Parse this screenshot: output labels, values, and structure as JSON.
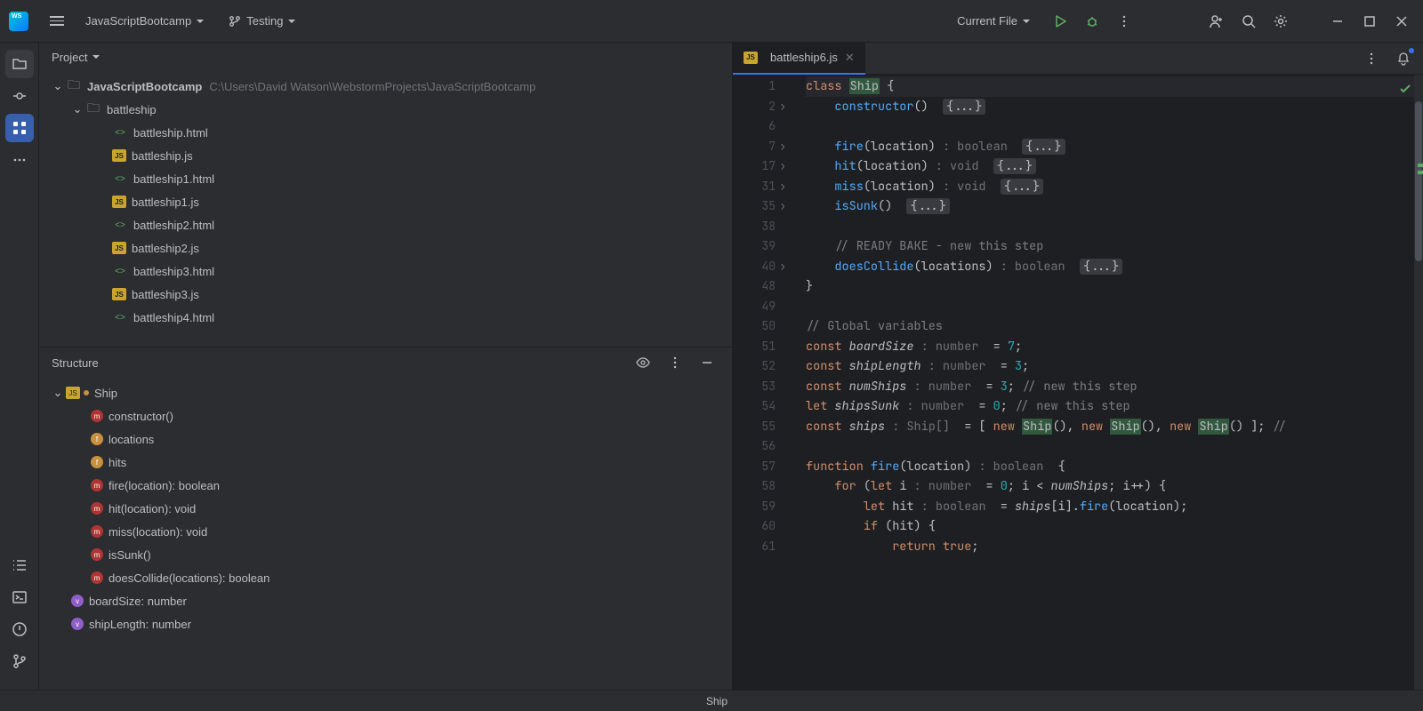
{
  "topbar": {
    "project_name": "JavaScriptBootcamp",
    "branch": "Testing",
    "run_config": "Current File"
  },
  "project_panel": {
    "title": "Project",
    "root": "JavaScriptBootcamp",
    "root_path": "C:\\Users\\David Watson\\WebstormProjects\\JavaScriptBootcamp",
    "folder": "battleship",
    "files": [
      {
        "name": "battleship.html",
        "type": "html"
      },
      {
        "name": "battleship.js",
        "type": "js"
      },
      {
        "name": "battleship1.html",
        "type": "html"
      },
      {
        "name": "battleship1.js",
        "type": "js"
      },
      {
        "name": "battleship2.html",
        "type": "html"
      },
      {
        "name": "battleship2.js",
        "type": "js"
      },
      {
        "name": "battleship3.html",
        "type": "html"
      },
      {
        "name": "battleship3.js",
        "type": "js"
      },
      {
        "name": "battleship4.html",
        "type": "html"
      }
    ]
  },
  "structure_panel": {
    "title": "Structure",
    "class_name": "Ship",
    "members": [
      {
        "icon": "method",
        "label": "constructor()"
      },
      {
        "icon": "field",
        "label": "locations"
      },
      {
        "icon": "field",
        "label": "hits"
      },
      {
        "icon": "method",
        "label": "fire(location): boolean"
      },
      {
        "icon": "method",
        "label": "hit(location): void"
      },
      {
        "icon": "method",
        "label": "miss(location): void"
      },
      {
        "icon": "method",
        "label": "isSunk()"
      },
      {
        "icon": "method",
        "label": "doesCollide(locations): boolean"
      }
    ],
    "globals": [
      {
        "icon": "var",
        "label": "boardSize: number"
      },
      {
        "icon": "var",
        "label": "shipLength: number"
      }
    ]
  },
  "editor": {
    "tab_name": "battleship6.js",
    "breadcrumb": "Ship",
    "gutter": [
      "1",
      "2",
      "6",
      "7",
      "17",
      "31",
      "35",
      "38",
      "39",
      "40",
      "48",
      "49",
      "50",
      "51",
      "52",
      "53",
      "54",
      "55",
      "56",
      "57",
      "58",
      "59",
      "60",
      "61"
    ],
    "folds": [
      1,
      3,
      4,
      5,
      6,
      9
    ],
    "lines": [
      {
        "t": "code",
        "segs": [
          [
            "kw",
            "class "
          ],
          [
            "cls",
            "Ship"
          ],
          [
            "",
            " {"
          ]
        ]
      },
      {
        "t": "fold",
        "segs": [
          [
            "",
            "    "
          ],
          [
            "fn",
            "constructor"
          ],
          [
            "",
            "()  "
          ],
          [
            "fold-badge",
            "{...}"
          ]
        ]
      },
      {
        "t": "blank"
      },
      {
        "t": "fold",
        "segs": [
          [
            "",
            "    "
          ],
          [
            "fn",
            "fire"
          ],
          [
            "",
            "("
          ],
          [
            "ident-nc",
            "location"
          ],
          [
            "",
            ") "
          ],
          [
            "hint",
            ": boolean"
          ],
          [
            "",
            "  "
          ],
          [
            "fold-badge",
            "{...}"
          ]
        ]
      },
      {
        "t": "fold",
        "segs": [
          [
            "",
            "    "
          ],
          [
            "fn",
            "hit"
          ],
          [
            "",
            "("
          ],
          [
            "ident-nc",
            "location"
          ],
          [
            "",
            ") "
          ],
          [
            "hint",
            ": void"
          ],
          [
            "",
            "  "
          ],
          [
            "fold-badge",
            "{...}"
          ]
        ]
      },
      {
        "t": "fold",
        "segs": [
          [
            "",
            "    "
          ],
          [
            "fn",
            "miss"
          ],
          [
            "",
            "("
          ],
          [
            "ident-nc",
            "location"
          ],
          [
            "",
            ") "
          ],
          [
            "hint",
            ": void"
          ],
          [
            "",
            "  "
          ],
          [
            "fold-badge",
            "{...}"
          ]
        ]
      },
      {
        "t": "fold",
        "segs": [
          [
            "",
            "    "
          ],
          [
            "fn",
            "isSunk"
          ],
          [
            "",
            "()  "
          ],
          [
            "fold-badge",
            "{...}"
          ]
        ]
      },
      {
        "t": "blank"
      },
      {
        "t": "code",
        "segs": [
          [
            "",
            "    "
          ],
          [
            "comment",
            "// READY BAKE - new this step"
          ]
        ]
      },
      {
        "t": "fold",
        "segs": [
          [
            "",
            "    "
          ],
          [
            "fn",
            "doesCollide"
          ],
          [
            "",
            "("
          ],
          [
            "ident-nc",
            "locations"
          ],
          [
            "",
            ") "
          ],
          [
            "hint",
            ": boolean"
          ],
          [
            "",
            "  "
          ],
          [
            "fold-badge",
            "{...}"
          ]
        ]
      },
      {
        "t": "code",
        "segs": [
          [
            "",
            "}"
          ]
        ]
      },
      {
        "t": "blank"
      },
      {
        "t": "code",
        "segs": [
          [
            "comment",
            "// Global variables"
          ]
        ]
      },
      {
        "t": "code",
        "segs": [
          [
            "kw",
            "const "
          ],
          [
            "ident",
            "boardSize"
          ],
          [
            "",
            " "
          ],
          [
            "hint",
            ": number"
          ],
          [
            "",
            "  = "
          ],
          [
            "num",
            "7"
          ],
          [
            "",
            ";"
          ]
        ]
      },
      {
        "t": "code",
        "segs": [
          [
            "kw",
            "const "
          ],
          [
            "ident",
            "shipLength"
          ],
          [
            "",
            " "
          ],
          [
            "hint",
            ": number"
          ],
          [
            "",
            "  = "
          ],
          [
            "num",
            "3"
          ],
          [
            "",
            ";"
          ]
        ]
      },
      {
        "t": "code",
        "segs": [
          [
            "kw",
            "const "
          ],
          [
            "ident",
            "numShips"
          ],
          [
            "",
            " "
          ],
          [
            "hint",
            ": number"
          ],
          [
            "",
            "  = "
          ],
          [
            "num",
            "3"
          ],
          [
            "",
            "; "
          ],
          [
            "comment",
            "// new this step"
          ]
        ]
      },
      {
        "t": "code",
        "segs": [
          [
            "kw",
            "let "
          ],
          [
            "ident",
            "shipsSunk"
          ],
          [
            "",
            " "
          ],
          [
            "hint",
            ": number"
          ],
          [
            "",
            "  = "
          ],
          [
            "num",
            "0"
          ],
          [
            "",
            "; "
          ],
          [
            "comment",
            "// new this step"
          ]
        ]
      },
      {
        "t": "code",
        "segs": [
          [
            "kw",
            "const "
          ],
          [
            "ident",
            "ships"
          ],
          [
            "",
            " "
          ],
          [
            "hint",
            ": Ship[]"
          ],
          [
            "",
            "  = [ "
          ],
          [
            "kw",
            "new "
          ],
          [
            "cls",
            "Ship"
          ],
          [
            "",
            "(), "
          ],
          [
            "kw",
            "new "
          ],
          [
            "cls",
            "Ship"
          ],
          [
            "",
            "(), "
          ],
          [
            "kw",
            "new "
          ],
          [
            "cls",
            "Ship"
          ],
          [
            "",
            "() ]; "
          ],
          [
            "comment",
            "//"
          ]
        ]
      },
      {
        "t": "blank"
      },
      {
        "t": "code",
        "segs": [
          [
            "kw",
            "function "
          ],
          [
            "fn",
            "fire"
          ],
          [
            "",
            "("
          ],
          [
            "ident-nc",
            "location"
          ],
          [
            "",
            ") "
          ],
          [
            "hint",
            ": boolean"
          ],
          [
            "",
            "  {"
          ]
        ]
      },
      {
        "t": "code",
        "segs": [
          [
            "",
            "    "
          ],
          [
            "kw",
            "for"
          ],
          [
            "",
            " ("
          ],
          [
            "kw",
            "let "
          ],
          [
            "ident-nc",
            "i"
          ],
          [
            "",
            " "
          ],
          [
            "hint",
            ": number"
          ],
          [
            "",
            "  = "
          ],
          [
            "num",
            "0"
          ],
          [
            "",
            "; i < "
          ],
          [
            "ident",
            "numShips"
          ],
          [
            "",
            "; i++) {"
          ]
        ]
      },
      {
        "t": "code",
        "segs": [
          [
            "",
            "        "
          ],
          [
            "kw",
            "let "
          ],
          [
            "ident-nc",
            "hit"
          ],
          [
            "",
            " "
          ],
          [
            "hint",
            ": boolean"
          ],
          [
            "",
            "  = "
          ],
          [
            "ident",
            "ships"
          ],
          [
            "",
            "[i]."
          ],
          [
            "fn",
            "fire"
          ],
          [
            "",
            "(location);"
          ]
        ]
      },
      {
        "t": "code",
        "segs": [
          [
            "",
            "        "
          ],
          [
            "kw",
            "if"
          ],
          [
            "",
            " (hit) {"
          ]
        ]
      },
      {
        "t": "code",
        "segs": [
          [
            "",
            "            "
          ],
          [
            "kw",
            "return "
          ],
          [
            "kw",
            "true"
          ],
          [
            "",
            ";"
          ]
        ]
      }
    ]
  }
}
